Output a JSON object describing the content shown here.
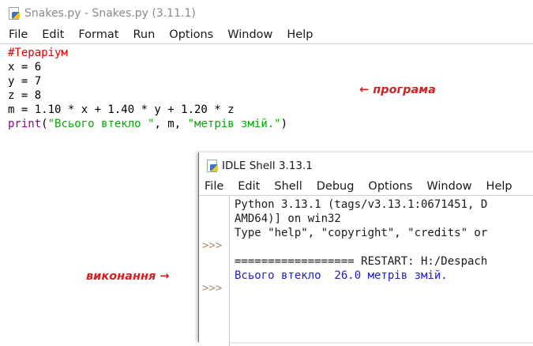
{
  "editor": {
    "title": "Snakes.py - Snakes.py (3.11.1)",
    "menu": [
      "File",
      "Edit",
      "Format",
      "Run",
      "Options",
      "Window",
      "Help"
    ],
    "code": {
      "line1": "#Тераріум",
      "line2": "x = 6",
      "line3": "y = 7",
      "line4": "z = 8",
      "line5": "m = 1.10 * x + 1.40 * y + 1.20 * z",
      "line6_builtin": "print",
      "line6_open": "(",
      "line6_str1": "\"Всього втекло \"",
      "line6_mid": ", m, ",
      "line6_str2": "\"метрів змій.\"",
      "line6_close": ")"
    }
  },
  "annotations": {
    "program": "← програма",
    "execution": "виконання →"
  },
  "shell": {
    "title": "IDLE Shell 3.13.1",
    "menu": [
      "File",
      "Edit",
      "Shell",
      "Debug",
      "Options",
      "Window",
      "Help"
    ],
    "prompt": ">>>",
    "lines": {
      "banner1": "Python 3.13.1 (tags/v3.13.1:0671451, D",
      "banner2": "AMD64)] on win32",
      "banner3": "Type \"help\", \"copyright\", \"credits\" or",
      "restart": "================== RESTART: H:/Despach",
      "output": "Всього втекло  26.0 метрів змій."
    }
  },
  "colors": {
    "comment": "#dd0000",
    "builtin": "#900090",
    "string": "#00aa00",
    "output": "#2020c8",
    "annotation": "#d42020"
  }
}
